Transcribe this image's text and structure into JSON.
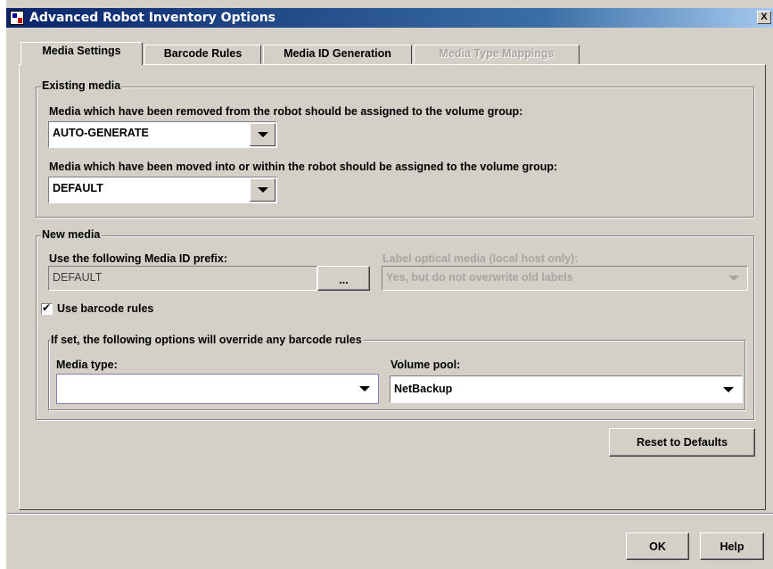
{
  "window": {
    "title": "Advanced Robot Inventory Options",
    "close_label": "X"
  },
  "tabs": [
    {
      "label": "Media Settings"
    },
    {
      "label": "Barcode Rules"
    },
    {
      "label": "Media ID Generation"
    },
    {
      "label": "Media Type Mappings"
    }
  ],
  "existing_media": {
    "title": "Existing media",
    "removed_label": "Media which have been removed from the robot should be assigned to the volume group:",
    "removed_value": "AUTO-GENERATE",
    "moved_label": "Media which have been moved into or within the robot should be assigned to the volume group:",
    "moved_value": "DEFAULT"
  },
  "new_media": {
    "title": "New media",
    "prefix_label": "Use the following Media ID prefix:",
    "prefix_value": "DEFAULT",
    "browse_label": "...",
    "optical_label": "Label optical media (local host only):",
    "optical_value": "Yes, but do not overwrite old labels",
    "use_barcode_label": "Use barcode rules",
    "use_barcode_checked": true,
    "override": {
      "title": "If set, the following options will override any barcode rules",
      "media_type_label": "Media type:",
      "media_type_value": "",
      "volume_pool_label": "Volume pool:",
      "volume_pool_value": "NetBackup"
    }
  },
  "buttons": {
    "reset": "Reset to Defaults",
    "ok": "OK",
    "help": "Help"
  }
}
